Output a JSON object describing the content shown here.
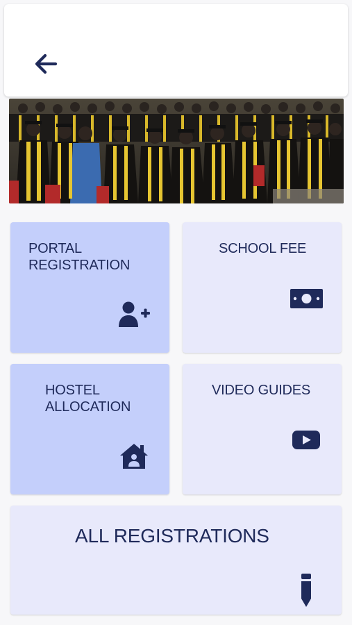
{
  "header": {
    "back_icon": "arrow-left-icon"
  },
  "banner": {
    "description_icon": "graduation-photo"
  },
  "colors": {
    "navy": "#1f2a5a",
    "card_blue": "#c4cffb",
    "card_lavender": "#e8e9fb",
    "background": "#f7f7f9"
  },
  "cards": {
    "portal_registration": {
      "line1": "PORTAL",
      "line2": "REGISTRATION",
      "icon": "add-user-icon"
    },
    "school_fee": {
      "line1": "SCHOOL FEE",
      "icon": "money-bill-icon"
    },
    "hostel_allocation": {
      "line1": "HOSTEL",
      "line2": "ALLOCATION",
      "icon": "house-user-icon"
    },
    "video_guides": {
      "line1": "VIDEO GUIDES",
      "icon": "youtube-play-icon"
    },
    "all_registrations": {
      "line1": "ALL REGISTRATIONS",
      "icon": "pencil-icon"
    }
  }
}
